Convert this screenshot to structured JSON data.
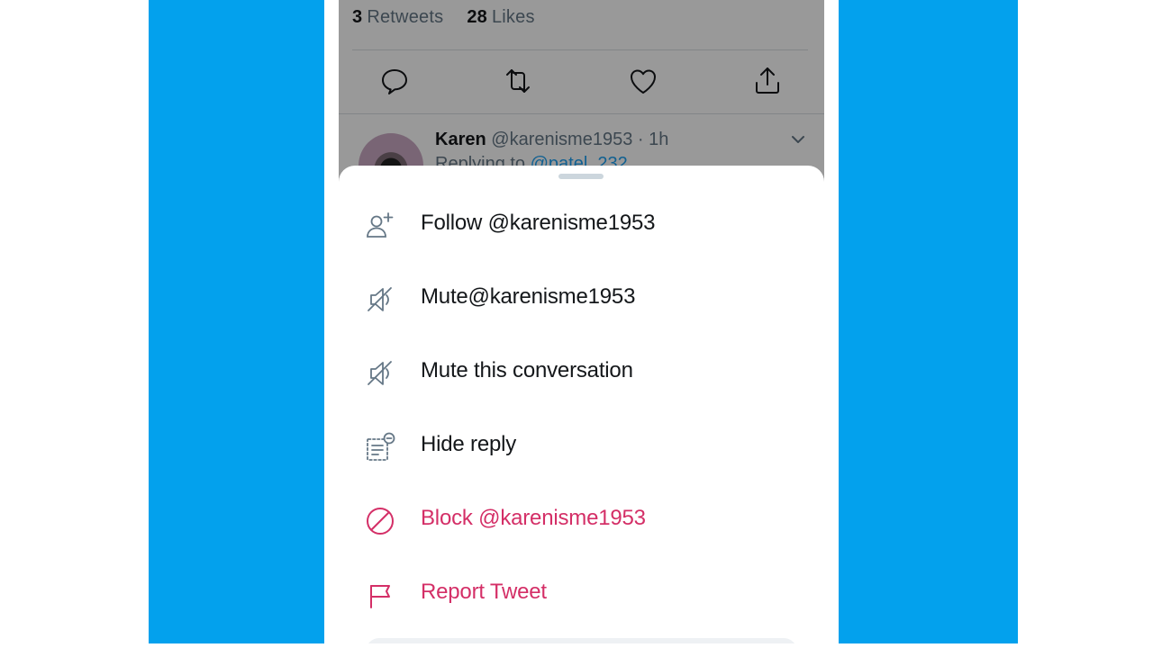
{
  "tweet": {
    "retweets_count": "3",
    "retweets_label": "Retweets",
    "likes_count": "28",
    "likes_label": "Likes",
    "actions": [
      "reply-icon",
      "retweet-icon",
      "like-icon",
      "share-icon"
    ]
  },
  "reply": {
    "name": "Karen",
    "handle": "@karenisme1953",
    "time": " · 1h",
    "replying_prefix": "Replying to ",
    "replying_mention": "@patel_232"
  },
  "sheet": {
    "items": [
      {
        "label": "Follow @karenisme1953",
        "icon": "follow-user-icon",
        "danger": false
      },
      {
        "label": "Mute@karenisme1953",
        "icon": "mute-icon",
        "danger": false
      },
      {
        "label": "Mute this conversation",
        "icon": "mute-conversation-icon",
        "danger": false
      },
      {
        "label": "Hide reply",
        "icon": "hide-reply-icon",
        "danger": false
      },
      {
        "label": "Block @karenisme1953",
        "icon": "block-icon",
        "danger": true
      },
      {
        "label": "Report Tweet",
        "icon": "flag-icon",
        "danger": true
      }
    ]
  },
  "colors": {
    "background_accent": "#03a1ed",
    "danger": "#d42f67",
    "text": "#14171a",
    "muted_text": "#657786",
    "link": "#1da1f2"
  }
}
